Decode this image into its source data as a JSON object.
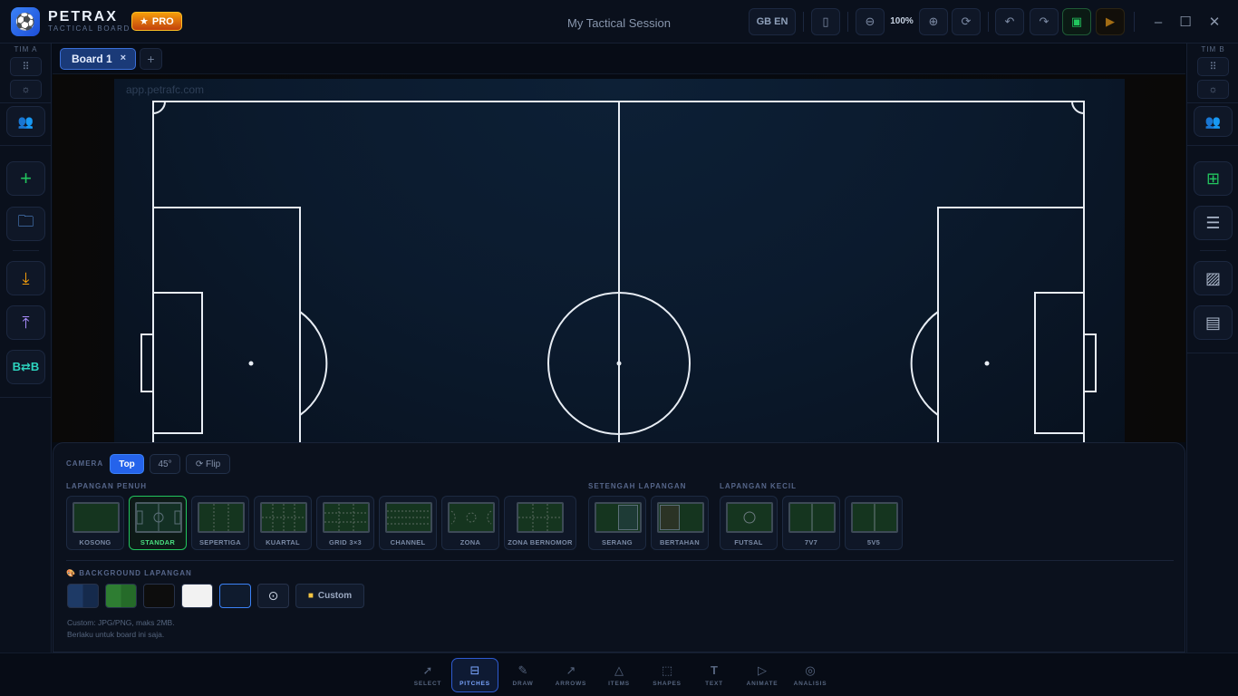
{
  "app": {
    "brand": "PETRAX",
    "brand_sub": "TACTICAL BOARD",
    "pro_badge": "PRO",
    "session_title": "My Tactical Session"
  },
  "header": {
    "language": "GB EN",
    "zoom": "100%",
    "icons": [
      "phone-icon",
      "zoom-out-icon",
      "zoom-in-icon",
      "refresh-icon",
      "undo-icon",
      "redo-icon",
      "save-icon",
      "record-icon"
    ],
    "window_controls": [
      "minimize-icon",
      "maximize-icon",
      "close-icon"
    ]
  },
  "left_rail": {
    "title": "TIM A",
    "buttons": [
      "grid-icon",
      "sun-icon",
      "players-icon",
      "add-icon",
      "folder-icon",
      "download-icon",
      "upload-icon",
      "swap-icon"
    ]
  },
  "right_rail": {
    "title": "TIM B",
    "buttons": [
      "grid-icon",
      "sun-icon",
      "players-icon",
      "layout-icon",
      "notes-icon",
      "image-icon",
      "document-icon"
    ]
  },
  "tabs": {
    "items": [
      {
        "label": "Board 1",
        "close": "×"
      }
    ],
    "add": "+"
  },
  "canvas": {
    "watermark": "app.petrafc.com"
  },
  "panel": {
    "camera_label": "CAMERA",
    "camera_options": [
      "Top",
      "45°",
      "⟳ Flip"
    ],
    "camera_selected": "Top",
    "full_pitch_label": "LAPANGAN PENUH",
    "half_pitch_label": "SETENGAH LAPANGAN",
    "small_pitch_label": "LAPANGAN KECIL",
    "full_pitches": [
      "KOSONG",
      "STANDAR",
      "SEPERTIGA",
      "KUARTAL",
      "GRID 3×3",
      "CHANNEL",
      "ZONA",
      "ZONA BERNOMOR"
    ],
    "half_pitches": [
      "SERANG",
      "BERTAHAN"
    ],
    "small_pitches": [
      "FUTSAL",
      "7V7",
      "5V5"
    ],
    "selected_pitch": "STANDAR",
    "background_label": "BACKGROUND LAPANGAN",
    "background_colors": [
      "#1e3a66",
      "#2e7d32",
      "#0d0d0d",
      "#f2f2f2",
      "#0f1b2e"
    ],
    "custom_button": "Custom",
    "note_line1": "Custom: JPG/PNG, maks 2MB.",
    "note_line2": "Berlaku untuk board ini saja."
  },
  "toolbar": {
    "tools": [
      {
        "label": "SELECT",
        "icon": "cursor-icon"
      },
      {
        "label": "PITCHES",
        "icon": "pitch-icon"
      },
      {
        "label": "DRAW",
        "icon": "pencil-icon"
      },
      {
        "label": "ARROWS",
        "icon": "arrow-icon"
      },
      {
        "label": "ITEMS",
        "icon": "cone-icon"
      },
      {
        "label": "SHAPES",
        "icon": "shapes-icon"
      },
      {
        "label": "TEXT",
        "icon": "text-icon"
      },
      {
        "label": "ANIMATE",
        "icon": "play-icon"
      },
      {
        "label": "ANALISIS",
        "icon": "analysis-icon"
      }
    ],
    "active": "PITCHES"
  }
}
